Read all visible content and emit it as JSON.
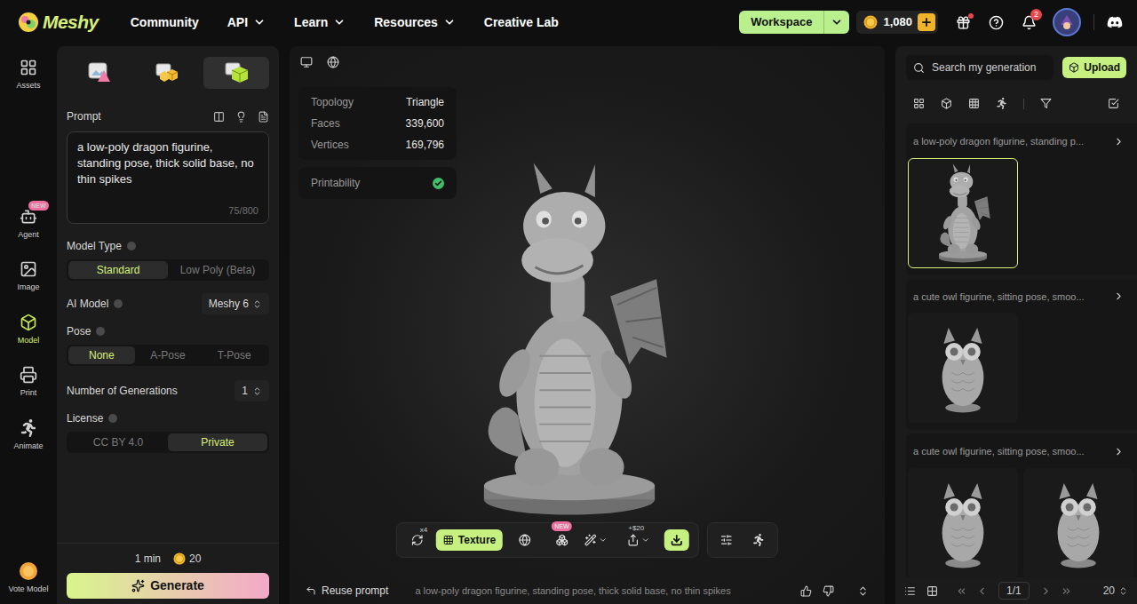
{
  "brand": {
    "name": "Meshy"
  },
  "nav": [
    {
      "label": "Community",
      "dropdown": false
    },
    {
      "label": "API",
      "dropdown": true
    },
    {
      "label": "Learn",
      "dropdown": true
    },
    {
      "label": "Resources",
      "dropdown": true
    },
    {
      "label": "Creative Lab",
      "dropdown": false
    }
  ],
  "workspace": {
    "label": "Workspace"
  },
  "credits": {
    "amount": "1,080"
  },
  "notifications": {
    "count": "2",
    "gift_unread": true
  },
  "rail": [
    {
      "label": "Assets",
      "selected": false,
      "badge": ""
    },
    {
      "label": "Agent",
      "selected": false,
      "badge": "NEW"
    },
    {
      "label": "Image",
      "selected": false,
      "badge": ""
    },
    {
      "label": "Model",
      "selected": true,
      "badge": ""
    },
    {
      "label": "Print",
      "selected": false,
      "badge": ""
    },
    {
      "label": "Animate",
      "selected": false,
      "badge": ""
    }
  ],
  "rail_footer": {
    "label": "Vote Model"
  },
  "panel_tabs": [
    {
      "kind": "text-to-image",
      "selected": false
    },
    {
      "kind": "image-to-3d",
      "selected": false
    },
    {
      "kind": "text-to-3d",
      "selected": true
    }
  ],
  "prompt": {
    "label": "Prompt",
    "value": "a low-poly dragon figurine, standing pose, thick solid base, no thin spikes",
    "count": "75/800"
  },
  "model_type": {
    "label": "Model Type",
    "options": [
      {
        "label": "Standard",
        "selected": true
      },
      {
        "label": "Low Poly (Beta)",
        "selected": false
      }
    ]
  },
  "ai_model": {
    "label": "AI Model",
    "value": "Meshy 6"
  },
  "pose": {
    "label": "Pose",
    "options": [
      {
        "label": "None",
        "selected": true
      },
      {
        "label": "A-Pose",
        "selected": false
      },
      {
        "label": "T-Pose",
        "selected": false
      }
    ]
  },
  "generations": {
    "label": "Number of Generations",
    "value": "1"
  },
  "license": {
    "label": "License",
    "options": [
      {
        "label": "CC BY 4.0",
        "selected": false
      },
      {
        "label": "Private",
        "selected": true
      }
    ]
  },
  "generate": {
    "time": "1 min",
    "cost": "20",
    "label": "Generate"
  },
  "viewport": {
    "stats": [
      {
        "label": "Topology",
        "value": "Triangle"
      },
      {
        "label": "Faces",
        "value": "339,600"
      },
      {
        "label": "Vertices",
        "value": "169,796"
      }
    ],
    "printability": {
      "label": "Printability",
      "ok": true
    }
  },
  "toolbar": {
    "remesh_count": "x4",
    "texture": "Texture",
    "new_badge": "NEW",
    "share_reward": "+$20"
  },
  "footer": {
    "reuse": "Reuse prompt",
    "prompt": "a low-poly dragon figurine, standing pose, thick solid base, no thin spikes"
  },
  "gallery": {
    "search_placeholder": "Search my generation",
    "upload": "Upload",
    "items": [
      {
        "title": "a low-poly dragon figurine, standing p...",
        "thumbs": [
          {
            "kind": "dragon",
            "selected": true
          }
        ]
      },
      {
        "title": "a cute owl figurine, sitting pose, smoo...",
        "thumbs": [
          {
            "kind": "owl",
            "selected": false
          }
        ]
      },
      {
        "title": "a cute owl figurine, sitting pose, smoo...",
        "thumbs": [
          {
            "kind": "owl",
            "selected": false
          },
          {
            "kind": "owl",
            "selected": false
          }
        ]
      }
    ]
  },
  "pagination": {
    "page": "1/1",
    "per_page": "20"
  }
}
